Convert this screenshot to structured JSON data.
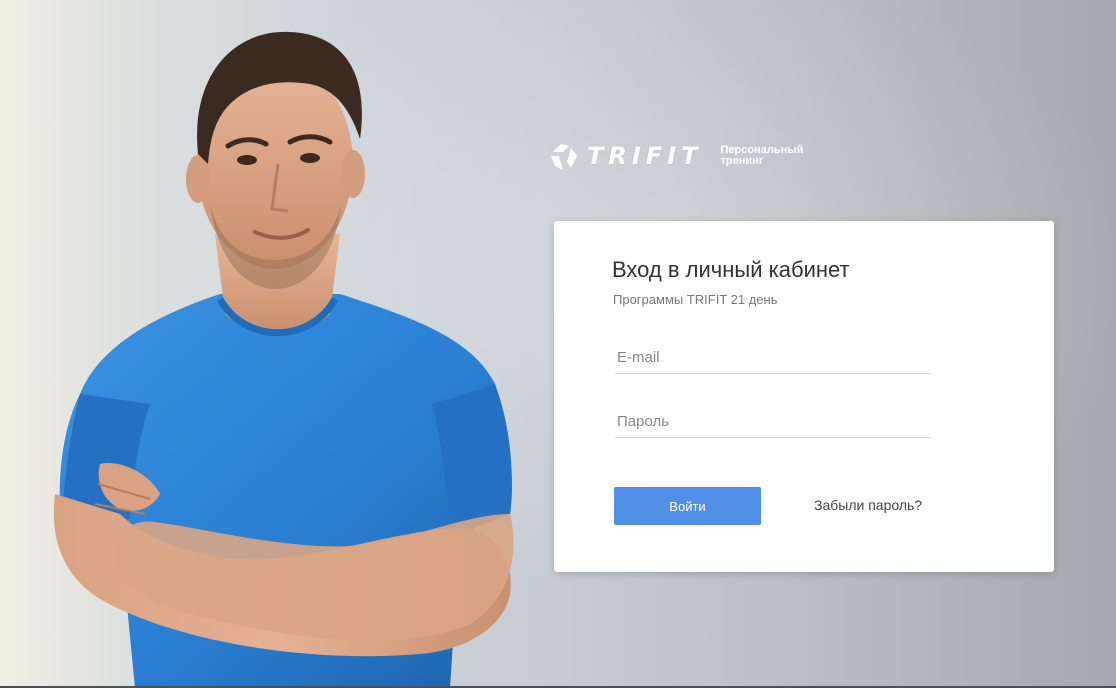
{
  "brand": {
    "name": "TRIFIT",
    "tagline_line1": "Персональный",
    "tagline_line2": "тренинг"
  },
  "login": {
    "title": "Вход в личный кабинет",
    "subtitle": "Программы TRIFIT 21 день",
    "email_placeholder": "E-mail",
    "password_placeholder": "Пароль",
    "submit_label": "Войти",
    "forgot_label": "Забыли пароль?"
  },
  "colors": {
    "button": "#4f8fe6",
    "shirt": "#2b82d4"
  },
  "icons": {
    "logo": "trifit-logo-icon"
  }
}
